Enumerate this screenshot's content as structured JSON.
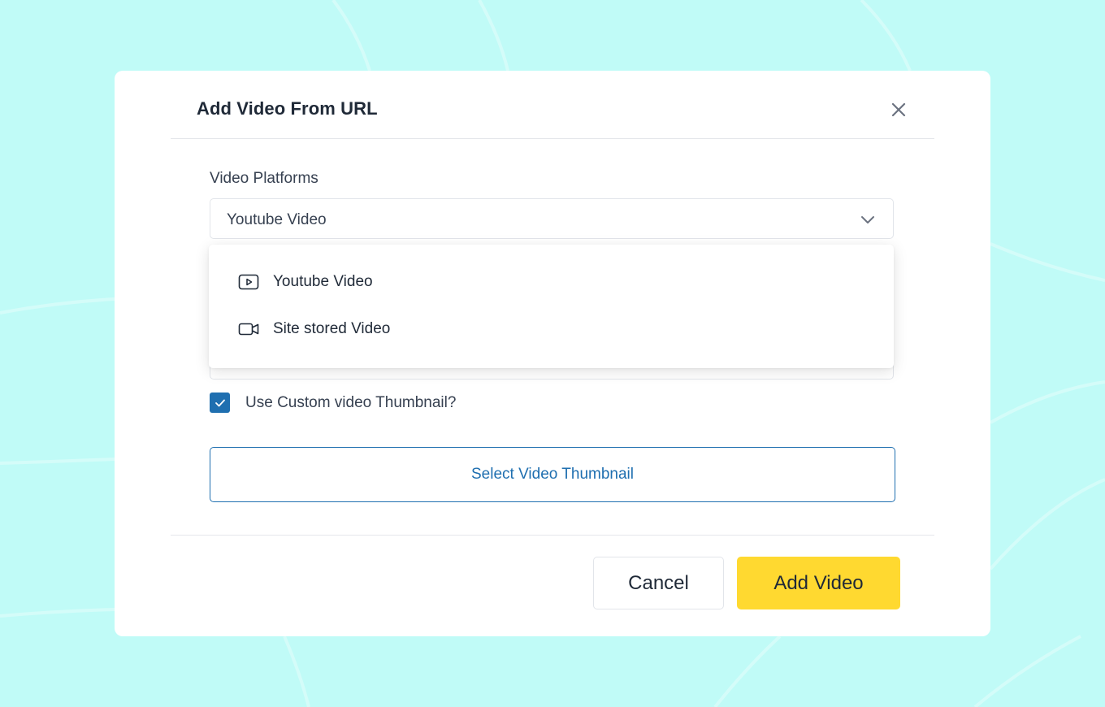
{
  "modal": {
    "title": "Add Video From URL"
  },
  "form": {
    "platform_label": "Video Platforms",
    "platform_selected": "Youtube Video",
    "dropdown_options": [
      {
        "label": "Youtube Video",
        "icon": "youtube-play-icon"
      },
      {
        "label": "Site stored Video",
        "icon": "video-camera-icon"
      }
    ],
    "custom_thumbnail_checked": true,
    "custom_thumbnail_label": "Use Custom video Thumbnail?",
    "select_thumbnail_label": "Select Video Thumbnail"
  },
  "footer": {
    "cancel_label": "Cancel",
    "add_label": "Add Video"
  },
  "colors": {
    "background": "#c0fbf7",
    "accent_blue": "#1f6fb0",
    "primary_yellow": "#ffd930"
  }
}
